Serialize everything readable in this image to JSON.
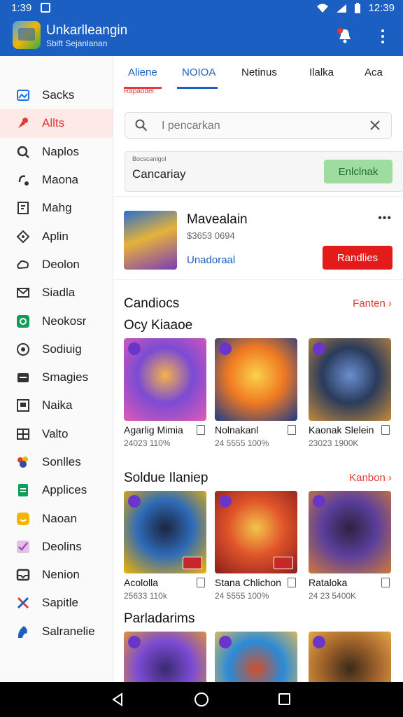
{
  "status": {
    "time_left": "1:39",
    "time_right": "12:39"
  },
  "app": {
    "title": "Unkarlleangin",
    "subtitle": "Sbift Sejanlanan"
  },
  "sidebar": {
    "items": [
      {
        "label": "Sacks",
        "icon": "image-icon",
        "color": "#1a73e8"
      },
      {
        "label": "Allts",
        "icon": "pin-icon",
        "color": "#e53935",
        "active": true
      },
      {
        "label": "Naplos",
        "icon": "search-gear-icon",
        "color": "#333333"
      },
      {
        "label": "Maona",
        "icon": "share-icon",
        "color": "#333333"
      },
      {
        "label": "Mahg",
        "icon": "book-icon",
        "color": "#333333"
      },
      {
        "label": "Aplin",
        "icon": "tag-icon",
        "color": "#333333"
      },
      {
        "label": "Deolon",
        "icon": "cloud-icon",
        "color": "#333333"
      },
      {
        "label": "Siadla",
        "icon": "mail-icon",
        "color": "#333333"
      },
      {
        "label": "Neokosr",
        "icon": "chat-icon",
        "color": "#0f9d58"
      },
      {
        "label": "Sodiuig",
        "icon": "target-icon",
        "color": "#333333"
      },
      {
        "label": "Smagies",
        "icon": "card-icon",
        "color": "#333333"
      },
      {
        "label": "Naika",
        "icon": "frame-icon",
        "color": "#333333"
      },
      {
        "label": "Valto",
        "icon": "grid-icon",
        "color": "#333333"
      },
      {
        "label": "Sonlles",
        "icon": "grape-icon",
        "color": "#e53935"
      },
      {
        "label": "Applices",
        "icon": "doc-icon",
        "color": "#0f9d58"
      },
      {
        "label": "Naoan",
        "icon": "smile-icon",
        "color": "#f4b400"
      },
      {
        "label": "Deolins",
        "icon": "check-icon",
        "color": "#ab47bc"
      },
      {
        "label": "Nenion",
        "icon": "inbox-icon",
        "color": "#333333"
      },
      {
        "label": "Sapitle",
        "icon": "cross-icon",
        "color": "#1a5fc1"
      },
      {
        "label": "Salranelie",
        "icon": "flame-icon",
        "color": "#1a5fc1"
      }
    ]
  },
  "tabs": [
    {
      "label": "Aliene",
      "active": true
    },
    {
      "label": "NOIOA",
      "active": true
    },
    {
      "label": "Netinus"
    },
    {
      "label": "Ilalka"
    },
    {
      "label": "Aca"
    }
  ],
  "tab_sub": "Rapaodel",
  "search": {
    "placeholder": "I pencarkan"
  },
  "category": {
    "tiny": "Bocscanlgol",
    "label": "Cancariay",
    "button": "Enlclnak"
  },
  "featured": {
    "title": "Mavealain",
    "meta": "$3653 0694",
    "link": "Unadoraal",
    "button": "Randlies"
  },
  "section1": {
    "title": "Candiocs",
    "more": "Fanten",
    "subtitle": "Ocy Kiaaoe"
  },
  "section2": {
    "title": "Soldue Ilaniep",
    "more": "Kanbon"
  },
  "section3": {
    "title": "Parladarims"
  },
  "row1": [
    {
      "name": "Agarlig Mimia",
      "meta": "24023 110%",
      "palette": [
        "#7b4bd4",
        "#e05ab5",
        "#f3b44a"
      ]
    },
    {
      "name": "Nolnakanl",
      "meta": "24 5555 100%",
      "palette": [
        "#f07a22",
        "#1e3b8a",
        "#fbd24a"
      ]
    },
    {
      "name": "Kaonak Slelein",
      "meta": "23023 1900K",
      "palette": [
        "#2a3b5c",
        "#c58a3c",
        "#6a8fd0"
      ]
    }
  ],
  "row2": [
    {
      "name": "Acololla",
      "meta": "25633 110k",
      "palette": [
        "#2e6bb8",
        "#f4b400",
        "#1b2540"
      ]
    },
    {
      "name": "Stana Chlichon",
      "meta": "24 5555 100%",
      "palette": [
        "#e0542a",
        "#8a1d1d",
        "#f5c44a"
      ]
    },
    {
      "name": "Rataloka",
      "meta": "24 23 5400K",
      "palette": [
        "#5b3f9c",
        "#d07a3a",
        "#2b2240"
      ]
    }
  ],
  "row3": [
    {
      "palette": [
        "#7b4bd4",
        "#f0a020",
        "#3a2a70"
      ]
    },
    {
      "palette": [
        "#2b8ad8",
        "#f5c44a",
        "#d0502a"
      ]
    },
    {
      "palette": [
        "#a0622a",
        "#f3b44a",
        "#3b2a1a"
      ]
    }
  ]
}
